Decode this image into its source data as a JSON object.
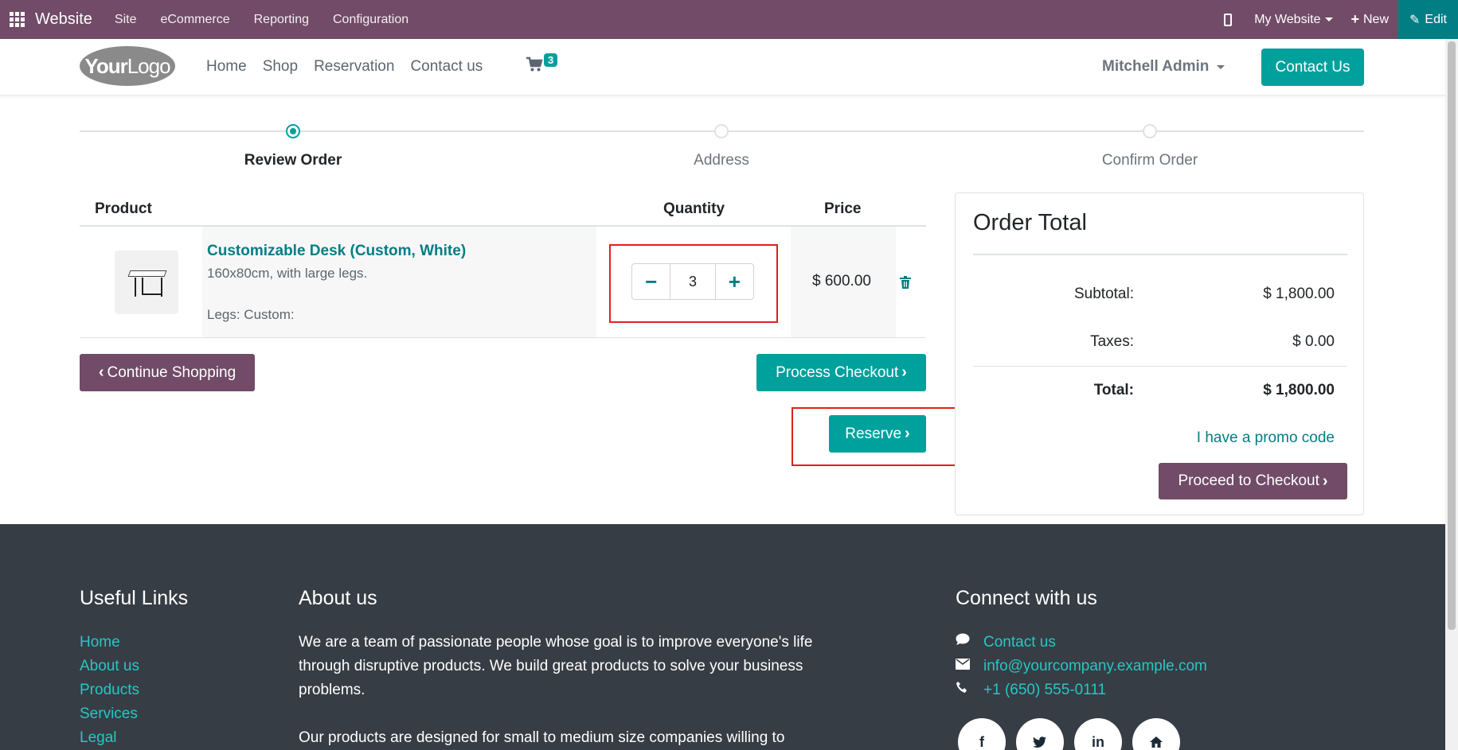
{
  "adminbar": {
    "brand": "Website",
    "menus": [
      "Site",
      "eCommerce",
      "Reporting",
      "Configuration"
    ],
    "website_selector": "My Website",
    "new_label": "New",
    "edit_label": "Edit",
    "color": "#714b67"
  },
  "header": {
    "logo_text_bold": "Your",
    "logo_text": "Logo",
    "nav": [
      "Home",
      "Shop",
      "Reservation",
      "Contact us"
    ],
    "cart_count": "3",
    "user": "Mitchell Admin",
    "contact_button": "Contact Us"
  },
  "wizard": {
    "steps": [
      "Review Order",
      "Address",
      "Confirm Order"
    ],
    "active_step": 0
  },
  "cart": {
    "columns": [
      "Product",
      "Quantity",
      "Price"
    ],
    "line": {
      "name": "Customizable Desk (Custom, White)",
      "description": "160x80cm, with large legs.",
      "attribute": "Legs: Custom:",
      "quantity": "3",
      "price": "$ 600.00"
    },
    "continue_shopping": "Continue Shopping",
    "process_checkout": "Process Checkout",
    "reserve": "Reserve"
  },
  "order_total": {
    "title": "Order Total",
    "subtotal_label": "Subtotal:",
    "subtotal": "$ 1,800.00",
    "taxes_label": "Taxes:",
    "taxes": "$ 0.00",
    "total_label": "Total:",
    "total": "$ 1,800.00",
    "promo": "I have a promo code",
    "proceed": "Proceed to Checkout"
  },
  "footer": {
    "useful_links_title": "Useful Links",
    "useful_links": [
      "Home",
      "About us",
      "Products",
      "Services",
      "Legal"
    ],
    "about_title": "About us",
    "about_p1": "We are a team of passionate people whose goal is to improve everyone's life through disruptive products. We build great products to solve your business problems.",
    "about_p2": "Our products are designed for small to medium size companies willing to",
    "connect_title": "Connect with us",
    "contact_link": "Contact us",
    "email": "info@yourcompany.example.com",
    "phone": "+1 (650) 555-0111",
    "social": [
      "facebook-icon",
      "twitter-icon",
      "linkedin-icon",
      "home-icon"
    ]
  },
  "colors": {
    "accent": "#00a09d",
    "link": "#017e84",
    "footer_bg": "#373d44",
    "highlight_box": "#e0201b"
  }
}
